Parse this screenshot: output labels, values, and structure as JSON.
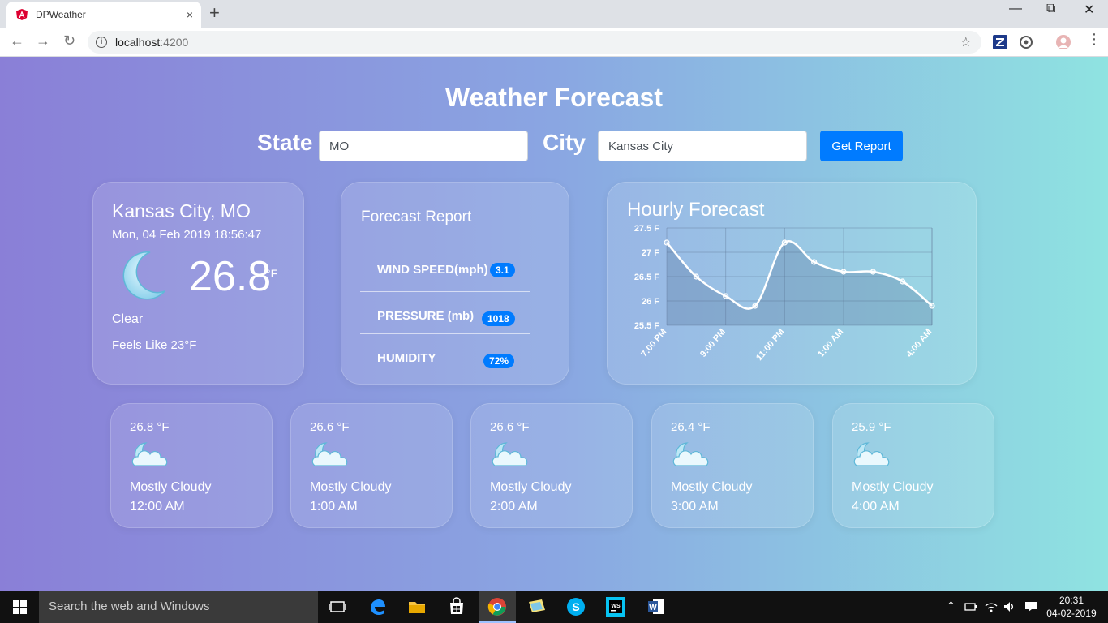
{
  "browser": {
    "tab_title": "DPWeather",
    "url_host": "localhost",
    "url_port": ":4200",
    "new_tab": "+",
    "tab_close": "×"
  },
  "page": {
    "title": "Weather Forecast",
    "state_label": "State",
    "state_value": "MO",
    "city_label": "City",
    "city_value": "Kansas City",
    "report_button": "Get Report"
  },
  "current": {
    "location": "Kansas City, MO",
    "datetime": "Mon, 04 Feb 2019 18:56:47",
    "temperature": "26.8",
    "unit": "°F",
    "condition": "Clear",
    "feels_like": "Feels Like 23°F",
    "icon": "moon-icon"
  },
  "forecast_report": {
    "title": "Forecast Report",
    "rows": [
      {
        "label": "WIND SPEED(mph)",
        "value": "3.1"
      },
      {
        "label": "PRESSURE (mb)",
        "value": "1018"
      },
      {
        "label": "HUMIDITY",
        "value": "72%"
      }
    ]
  },
  "hourly": {
    "title": "Hourly Forecast"
  },
  "chart_data": {
    "type": "area",
    "title": "Hourly Forecast",
    "x_tick_labels": [
      "7:00 PM",
      "9:00 PM",
      "11:00 PM",
      "1:00 AM",
      "4:00 AM"
    ],
    "y_tick_labels": [
      "27.5 F",
      "27 F",
      "26.5 F",
      "26 F",
      "25.5 F"
    ],
    "ylim": [
      25.5,
      27.5
    ],
    "series": [
      {
        "values": [
          27.2,
          26.5,
          26.1,
          25.9,
          27.2,
          26.8,
          26.6,
          26.6,
          26.4,
          25.9
        ]
      }
    ],
    "grid": true
  },
  "forecast_cards": [
    {
      "temp": "26.8 °F",
      "condition": "Mostly Cloudy",
      "time": "12:00 AM"
    },
    {
      "temp": "26.6 °F",
      "condition": "Mostly Cloudy",
      "time": "1:00 AM"
    },
    {
      "temp": "26.6 °F",
      "condition": "Mostly Cloudy",
      "time": "2:00 AM"
    },
    {
      "temp": "26.4 °F",
      "condition": "Mostly Cloudy",
      "time": "3:00 AM"
    },
    {
      "temp": "25.9 °F",
      "condition": "Mostly Cloudy",
      "time": "4:00 AM"
    }
  ],
  "taskbar": {
    "search_placeholder": "Search the web and Windows",
    "time": "20:31",
    "date": "04-02-2019"
  },
  "colors": {
    "accent": "#007bff",
    "gradient_start": "#8a7fd7",
    "gradient_end": "#8fe3e1"
  }
}
